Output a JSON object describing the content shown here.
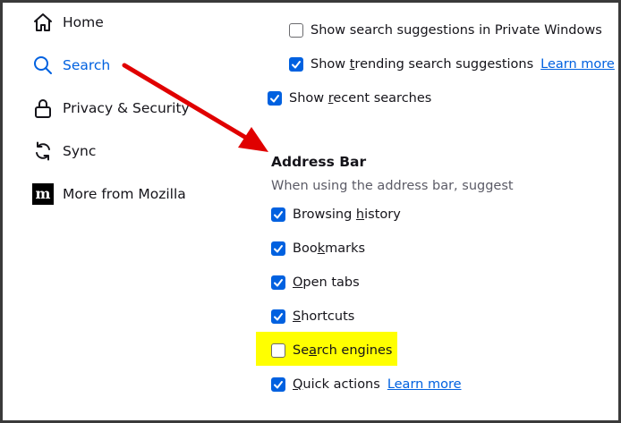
{
  "colors": {
    "accent": "#0061e0",
    "annotation_arrow": "#e00000",
    "highlight": "#ffff00"
  },
  "sidebar": {
    "items": [
      {
        "label": "Home",
        "icon": "home-icon"
      },
      {
        "label": "Search",
        "icon": "search-icon",
        "selected": true
      },
      {
        "label": "Privacy & Security",
        "icon": "lock-icon"
      },
      {
        "label": "Sync",
        "icon": "sync-icon"
      },
      {
        "label": "More from Mozilla",
        "icon": "mozilla-icon"
      }
    ]
  },
  "search_settings": {
    "private_suggestions": {
      "label": "Show search suggestions in Private Windows",
      "checked": false
    },
    "trending": {
      "pre": "Show ",
      "key": "t",
      "post": "rending search suggestions",
      "checked": true,
      "link": "Learn more"
    },
    "recent": {
      "pre": "Show ",
      "key": "r",
      "post": "ecent searches",
      "checked": true
    }
  },
  "address_bar": {
    "heading": "Address Bar",
    "subheading": "When using the address bar, suggest",
    "options": [
      {
        "pre": "Browsing ",
        "key": "h",
        "post": "istory",
        "checked": true
      },
      {
        "pre": "Boo",
        "key": "k",
        "post": "marks",
        "checked": true
      },
      {
        "pre": "",
        "key": "O",
        "post": "pen tabs",
        "checked": true
      },
      {
        "pre": "",
        "key": "S",
        "post": "hortcuts",
        "checked": true
      },
      {
        "pre": "Se",
        "key": "a",
        "post": "rch engines",
        "checked": false,
        "highlighted": true
      },
      {
        "pre": "",
        "key": "Q",
        "post": "uick actions",
        "checked": true,
        "link": "Learn more"
      }
    ]
  }
}
